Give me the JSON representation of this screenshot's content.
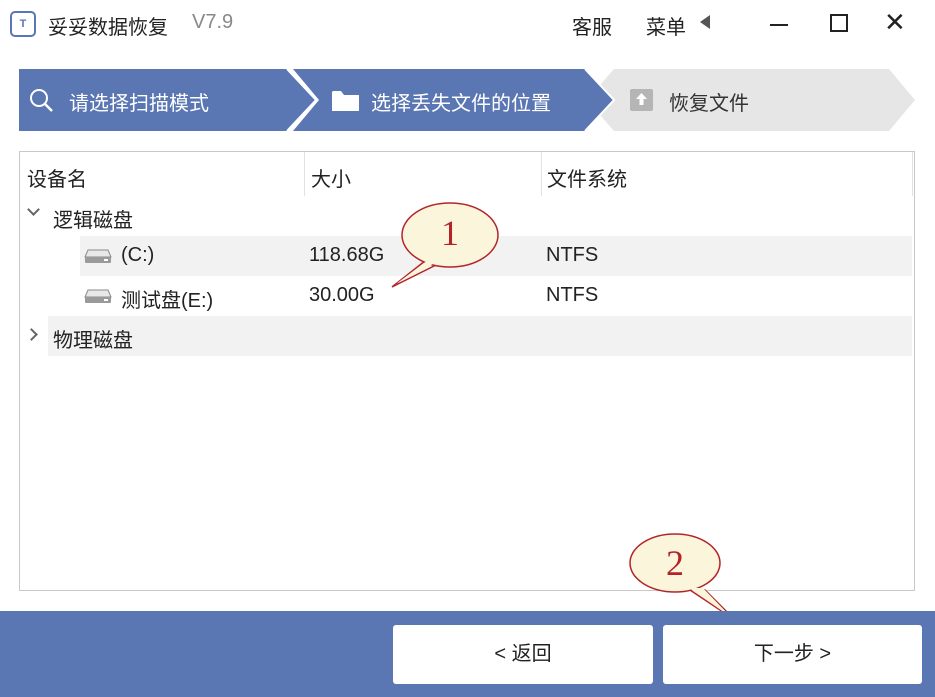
{
  "app": {
    "logo_text": "T",
    "title": "妥妥数据恢复",
    "version": "V7.9",
    "service_label": "客服",
    "menu_label": "菜单",
    "close_symbol": "✕"
  },
  "steps": [
    {
      "label": "请选择扫描模式",
      "icon": "search-icon",
      "state": "completed"
    },
    {
      "label": "选择丢失文件的位置",
      "icon": "folder-icon",
      "state": "active"
    },
    {
      "label": "恢复文件",
      "icon": "upload-icon",
      "state": "pending"
    }
  ],
  "table": {
    "headers": [
      "设备名",
      "大小",
      "文件系统"
    ],
    "groups": [
      {
        "name": "逻辑磁盘",
        "expanded": true,
        "items": [
          {
            "name": "(C:)",
            "size": "118.68G",
            "fs": "NTFS"
          },
          {
            "name": "测试盘(E:)",
            "size": "30.00G",
            "fs": "NTFS"
          }
        ]
      },
      {
        "name": "物理磁盘",
        "expanded": false,
        "items": []
      }
    ]
  },
  "callouts": [
    "1",
    "2"
  ],
  "footer": {
    "back_label": "< 返回",
    "next_label": "下一步 >"
  },
  "colors": {
    "accent": "#5a76b3",
    "step_pending": "#e6e6e6",
    "callout_fill": "#fbf5dc",
    "callout_border": "#b3242a",
    "row_highlight": "#f2f2f2"
  }
}
